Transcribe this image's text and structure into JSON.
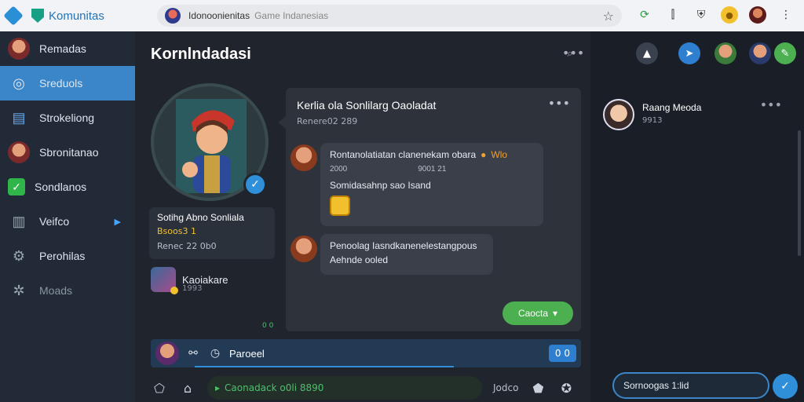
{
  "browser": {
    "brand": "Komunitas",
    "url_main": "Idonoonienitas",
    "url_sub": "Game Indanesias"
  },
  "sidebar": {
    "items": [
      {
        "label": "Remadas",
        "icon": "avatar-icon"
      },
      {
        "label": "Sreduols",
        "icon": "target-icon"
      },
      {
        "label": "Strokeliong",
        "icon": "book-icon"
      },
      {
        "label": "Sbronitanao",
        "icon": "face-icon"
      },
      {
        "label": "Sondlanos",
        "icon": "check-icon"
      },
      {
        "label": "Veifco",
        "icon": "building-icon"
      },
      {
        "label": "Perohilas",
        "icon": "gear-icon"
      },
      {
        "label": "Moads",
        "icon": "settings-icon"
      }
    ]
  },
  "main": {
    "title": "Kornlndadasi",
    "profile": {
      "name": "Sotihg Abno Sonliala",
      "coins": "Bsoos3 1",
      "sub": "Renec 22 0b0"
    },
    "friend": {
      "name": "Kaoiakare",
      "sub": "1993"
    },
    "tiny_status": "0 0",
    "chat": {
      "title": "Kerlia ola Sonlilarg Oaoladat",
      "meta": "Renere02 289",
      "messages": [
        {
          "line1": "Rontanolatiatan clanenekam obara",
          "line1_accent": "Wlo",
          "line2a": "2000",
          "line2b": "9001 21",
          "line3": "Somidasahnp sao Isand"
        },
        {
          "line1": "Penoolag Iasndkanenelestangpous",
          "line2": "Aehnde ooled"
        }
      ],
      "action_pill": "Caocta"
    },
    "compose": {
      "text": "Paroeel",
      "count": "0 0"
    },
    "bottom": {
      "field": "Caonadack o0li 8890",
      "right": "Jodco"
    }
  },
  "right": {
    "card": {
      "name": "Raang Meoda",
      "sub": "9913"
    },
    "search_value": "Sornoogas 1:lid"
  },
  "colors": {
    "accent": "#3a86c8",
    "green": "#4caf50",
    "coin": "#f2c02c"
  }
}
